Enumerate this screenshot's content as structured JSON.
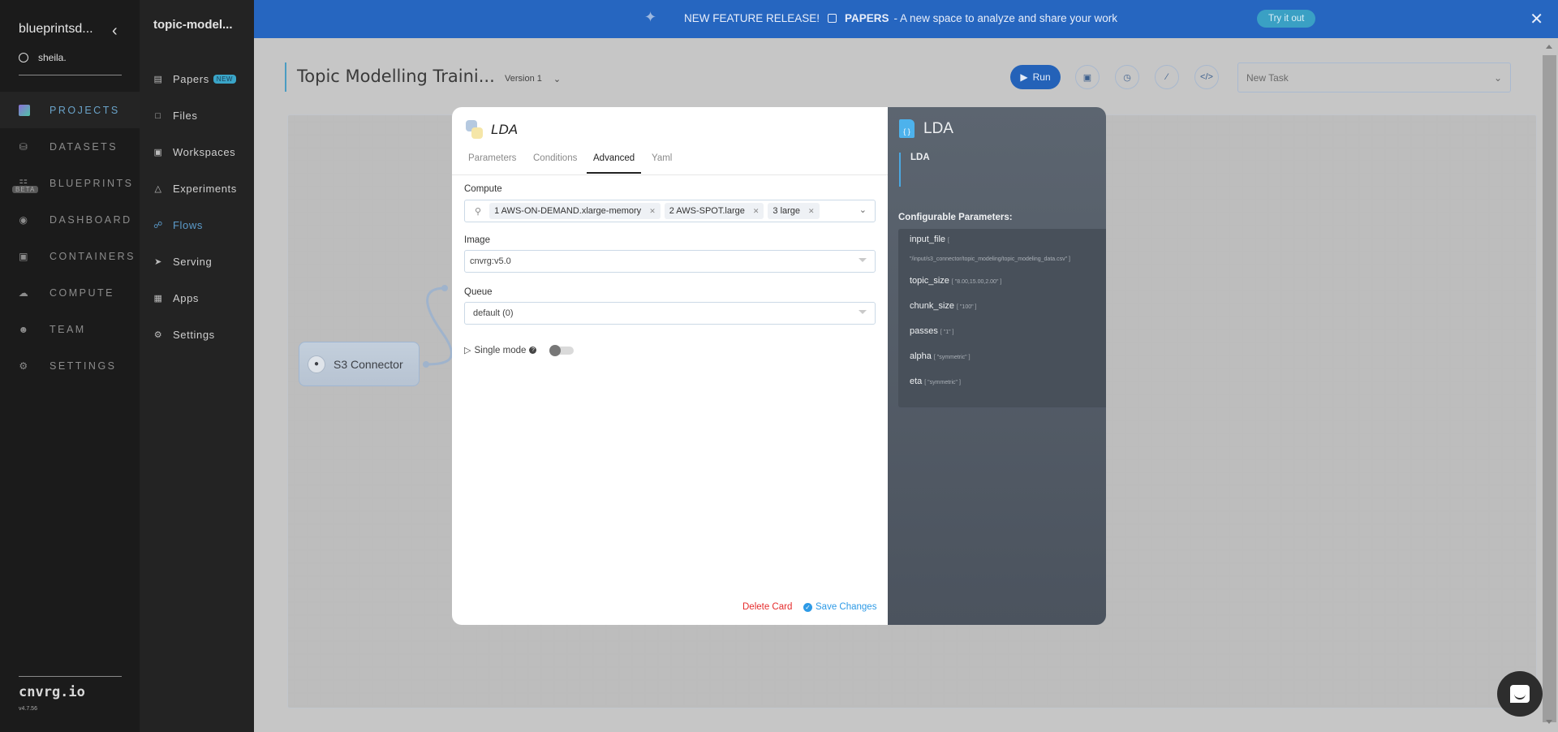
{
  "sidebar": {
    "org": "blueprintsd...",
    "user": "sheila.",
    "items": [
      {
        "label": "PROJECTS",
        "icon": "projects-icon",
        "active": true
      },
      {
        "label": "DATASETS",
        "icon": "database-icon"
      },
      {
        "label": "BLUEPRINTS",
        "icon": "blueprints-icon",
        "badge": "BETA"
      },
      {
        "label": "DASHBOARD",
        "icon": "dashboard-icon"
      },
      {
        "label": "CONTAINERS",
        "icon": "containers-icon"
      },
      {
        "label": "COMPUTE",
        "icon": "cloud-icon"
      },
      {
        "label": "TEAM",
        "icon": "team-icon"
      },
      {
        "label": "SETTINGS",
        "icon": "settings-icon"
      }
    ],
    "brand": "cnvrg.io",
    "version": "v4.7.56"
  },
  "project_nav": {
    "title": "topic-model...",
    "items": [
      {
        "label": "Papers",
        "badge": "NEW"
      },
      {
        "label": "Files"
      },
      {
        "label": "Workspaces"
      },
      {
        "label": "Experiments"
      },
      {
        "label": "Flows",
        "active": true
      },
      {
        "label": "Serving"
      },
      {
        "label": "Apps"
      },
      {
        "label": "Settings"
      }
    ]
  },
  "banner": {
    "prefix": "NEW FEATURE RELEASE!",
    "feature": "PAPERS",
    "text": "- A new space to analyze and share your work",
    "cta": "Try it out",
    "close": "✕"
  },
  "flow": {
    "title": "Topic Modelling Traini...",
    "version": "Version 1",
    "run_label": "Run",
    "task_select": "New Task"
  },
  "canvas": {
    "nodes": [
      {
        "label": "S3 Connector"
      }
    ]
  },
  "modal": {
    "title": "LDA",
    "tabs": [
      "Parameters",
      "Conditions",
      "Advanced",
      "Yaml"
    ],
    "active_tab": "Advanced",
    "compute_label": "Compute",
    "compute_chips": [
      "1 AWS-ON-DEMAND.xlarge-memory",
      "2 AWS-SPOT.large",
      "3 large"
    ],
    "image_label": "Image",
    "image_value": "cnvrg:v5.0",
    "queue_label": "Queue",
    "queue_value": "default (0)",
    "single_mode_label": "Single mode",
    "single_mode_on": false,
    "delete_label": "Delete Card",
    "save_label": "Save Changes"
  },
  "info_panel": {
    "title": "LDA",
    "description": "LDA",
    "configurable_label": "Configurable Parameters:",
    "params": [
      {
        "name": "input_file",
        "value": "[",
        "value_line2": "\"/input/s3_connector/topic_modeling/topic_modeling_data.csv\" ]"
      },
      {
        "name": "topic_size",
        "value": "[ \"8.00,15.00,2.00\" ]"
      },
      {
        "name": "chunk_size",
        "value": "[ \"100\" ]"
      },
      {
        "name": "passes",
        "value": "[ \"1\" ]"
      },
      {
        "name": "alpha",
        "value": "[ \"symmetric\" ]"
      },
      {
        "name": "eta",
        "value": "[ \"symmetric\" ]"
      }
    ]
  }
}
